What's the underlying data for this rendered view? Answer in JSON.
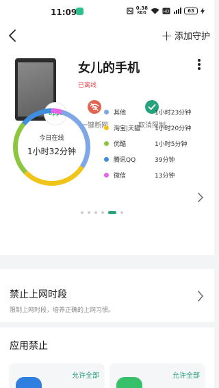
{
  "status_bar": {
    "time": "11:09",
    "net_speed_value": "0.38",
    "net_speed_unit": "KB/S",
    "battery": "63"
  },
  "header": {
    "add_guard_label": "添加守护"
  },
  "device": {
    "name": "女儿的手机",
    "status": "已离线",
    "brand_badge": "oppo"
  },
  "actions": [
    {
      "label": "一键断网",
      "icon": "wifi-off-icon",
      "color": "#e06450"
    },
    {
      "label": "取消限制",
      "icon": "check-icon",
      "color": "#27a27c"
    }
  ],
  "usage": {
    "caption": "今日在线",
    "total": "1小时32分钟"
  },
  "chart_data": {
    "type": "pie",
    "categories": [
      "其他",
      "淘宝|天猫",
      "优酷",
      "腾讯QQ",
      "微信"
    ],
    "values": [
      83,
      80,
      65,
      39,
      13
    ],
    "display_values": [
      "1小时23分钟",
      "1小时20分钟",
      "1小时5分钟",
      "39分钟",
      "13分钟"
    ],
    "colors": [
      "#7fa7e6",
      "#f0c419",
      "#8cc63f",
      "#3f8ee0",
      "#e764e8"
    ],
    "center_caption": "今日在线",
    "center_value": "1小时32分钟"
  },
  "pager": {
    "count": 6,
    "active_index": 4
  },
  "ban_time": {
    "title": "禁止上网时段",
    "description": "限制上网时段，培养正确的上网习惯。"
  },
  "app_ban": {
    "title": "应用禁止",
    "cards": [
      {
        "allow_label": "允许全部",
        "icon_color": "#2f7fe0"
      },
      {
        "allow_label": "允许全部",
        "icon_color": "#37c06a"
      }
    ]
  }
}
